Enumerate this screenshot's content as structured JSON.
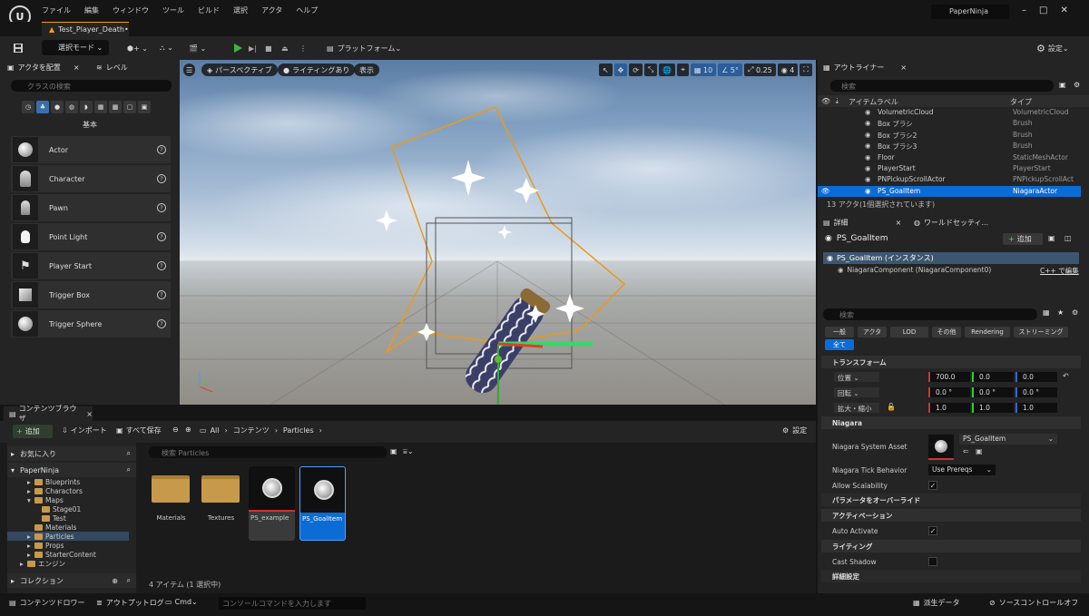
{
  "menubar": {
    "logo": "U",
    "items": [
      "ファイル",
      "編集",
      "ウィンドウ",
      "ツール",
      "ビルド",
      "選択",
      "アクタ",
      "ヘルプ"
    ],
    "project": "PaperNinja",
    "window_controls": [
      "–",
      "□",
      "✕"
    ]
  },
  "document_tab": {
    "label": "Test_Player_Death•"
  },
  "toolbar": {
    "select_mode": "選択モード",
    "platform": "プラットフォーム",
    "settings": "設定"
  },
  "left_panel": {
    "tab_place": "アクタを配置",
    "tab_levels": "レベル",
    "search_placeholder": "クラスの検索",
    "category": "基本",
    "actors": [
      {
        "label": "Actor",
        "icon": "sphere-icon"
      },
      {
        "label": "Character",
        "icon": "character-icon"
      },
      {
        "label": "Pawn",
        "icon": "pawn-icon"
      },
      {
        "label": "Point Light",
        "icon": "light-bulb-icon"
      },
      {
        "label": "Player Start",
        "icon": "flag-icon"
      },
      {
        "label": "Trigger Box",
        "icon": "cube-icon"
      },
      {
        "label": "Trigger Sphere",
        "icon": "sphere-icon"
      }
    ]
  },
  "viewport": {
    "perspective": "パースペクティブ",
    "lighting": "ライティングあり",
    "show": "表示",
    "grid_snap": "10",
    "angle_snap": "5°",
    "scale_snap": "0.25",
    "camera_speed": "4"
  },
  "content_browser": {
    "tab": "コンテンツブラウザ",
    "add": "追加",
    "import": "インポート",
    "save_all": "すべて保存",
    "path": [
      "All",
      "コンテンツ",
      "Particles"
    ],
    "settings": "設定",
    "favorites": "お気に入り",
    "project_root": "PaperNinja",
    "collections": "コレクション",
    "tree": [
      {
        "label": "Blueprints",
        "indent": 1,
        "arrow": "▸",
        "selected": false
      },
      {
        "label": "Charactors",
        "indent": 1,
        "arrow": "▸",
        "selected": false
      },
      {
        "label": "Maps",
        "indent": 1,
        "arrow": "▾",
        "selected": false
      },
      {
        "label": "Stage01",
        "indent": 2,
        "arrow": "",
        "selected": false
      },
      {
        "label": "Test",
        "indent": 2,
        "arrow": "",
        "selected": false
      },
      {
        "label": "Materials",
        "indent": 1,
        "arrow": "",
        "selected": false
      },
      {
        "label": "Particles",
        "indent": 1,
        "arrow": "▸",
        "selected": true
      },
      {
        "label": "Props",
        "indent": 1,
        "arrow": "▸",
        "selected": false
      },
      {
        "label": "StarterContent",
        "indent": 1,
        "arrow": "▸",
        "selected": false
      },
      {
        "label": "エンジン",
        "indent": 0,
        "arrow": "▸",
        "selected": false
      }
    ],
    "search_placeholder": "検索 Particles",
    "assets": [
      {
        "label": "Materials",
        "type": "folder"
      },
      {
        "label": "Textures",
        "type": "folder"
      },
      {
        "label": "PS_example",
        "type": "niagara"
      },
      {
        "label": "PS_GoalItem",
        "type": "niagara",
        "selected": true
      }
    ],
    "status": "4 アイテム (1 選択中)"
  },
  "outliner": {
    "tab": "アウトライナー",
    "search_placeholder": "検索",
    "col_label": "アイテムラベル",
    "col_type": "タイプ",
    "rows": [
      {
        "label": "VolumetricCloud",
        "type": "VolumetricCloud"
      },
      {
        "label": "Box ブラシ",
        "type": "Brush"
      },
      {
        "label": "Box ブラシ2",
        "type": "Brush"
      },
      {
        "label": "Box ブラシ3",
        "type": "Brush"
      },
      {
        "label": "Floor",
        "type": "StaticMeshActor"
      },
      {
        "label": "PlayerStart",
        "type": "PlayerStart"
      },
      {
        "label": "PNPickupScrollActor",
        "type": "PNPickupScrollAct"
      },
      {
        "label": "PS_GoalItem",
        "type": "NiagaraActor",
        "selected": true
      }
    ],
    "count": "13 アクタ(1個選択されています)"
  },
  "details": {
    "tab_details": "詳細",
    "tab_world": "ワールドセッティ...",
    "actor_name": "PS_GoalItem",
    "add": "追加",
    "instance": "PS_GoalItem (インスタンス)",
    "component": "NiagaraComponent (NiagaraComponent0)",
    "cpp": "C++ で編集",
    "search_placeholder": "検索",
    "filters": [
      "一般",
      "アクタ",
      "LOD",
      "その他",
      "Rendering",
      "ストリーミング"
    ],
    "filter_all": "全て",
    "transform": {
      "header": "トランスフォーム",
      "location_label": "位置",
      "rotation_label": "回転",
      "scale_label": "拡大・縮小",
      "location": [
        "700.0",
        "0.0",
        "0.0"
      ],
      "rotation": [
        "0.0 °",
        "0.0 °",
        "0.0 °"
      ],
      "scale": [
        "1.0",
        "1.0",
        "1.0"
      ]
    },
    "niagara": {
      "header": "Niagara",
      "asset_label": "Niagara System Asset",
      "asset_value": "PS_GoalItem",
      "tick_label": "Niagara Tick Behavior",
      "tick_value": "Use Prereqs",
      "scal_label": "Allow Scalability",
      "override_header": "パラメータをオーバーライド"
    },
    "activation": {
      "header": "アクティベーション",
      "auto_label": "Auto Activate"
    },
    "lighting": {
      "header": "ライティング",
      "shadow_label": "Cast Shadow"
    },
    "advanced": "詳細設定"
  },
  "bottom": {
    "drawer": "コンテンツドロワー",
    "output": "アウトプットログ",
    "cmd": "Cmd",
    "cmd_placeholder": "コンソールコマンドを入力します",
    "derived": "派生データ",
    "source_control": "ソースコントロールオフ"
  }
}
